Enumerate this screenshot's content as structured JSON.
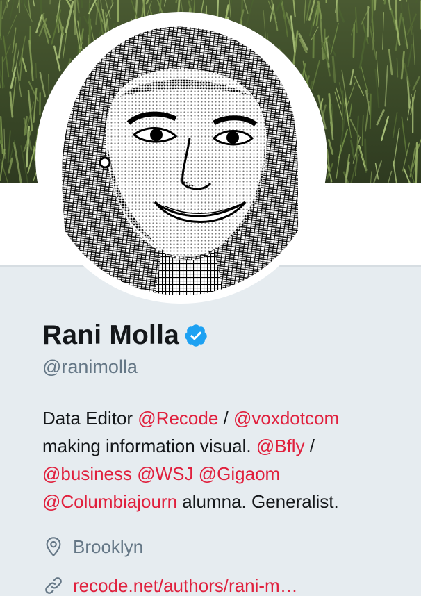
{
  "profile": {
    "name": "Rani Molla",
    "handle": "@ranimolla",
    "verified": true,
    "bio": {
      "line1_text1": "Data Editor ",
      "line1_mention1": "@Recode",
      "line1_text2": " / ",
      "line1_mention2": "@voxdotcom",
      "line2_text1": "making information visual. ",
      "line2_mention1": "@Bfly",
      "line2_text2": " /",
      "line3_mention1": "@business",
      "line3_mention2": "@WSJ",
      "line3_mention3": "@Gigaom",
      "line4_mention1": "@Columbiajourn",
      "line4_text1": " alumna. Generalist."
    },
    "location": "Brooklyn",
    "website": "recode.net/authors/rani-m…"
  },
  "icons": {
    "verified": "verified-badge-icon",
    "location": "location-pin-icon",
    "link": "link-icon"
  },
  "colors": {
    "accent": "#e0203d",
    "verified": "#1da1f2",
    "background": "#e6ecf0",
    "text": "#14171a",
    "secondary_text": "#657786"
  }
}
